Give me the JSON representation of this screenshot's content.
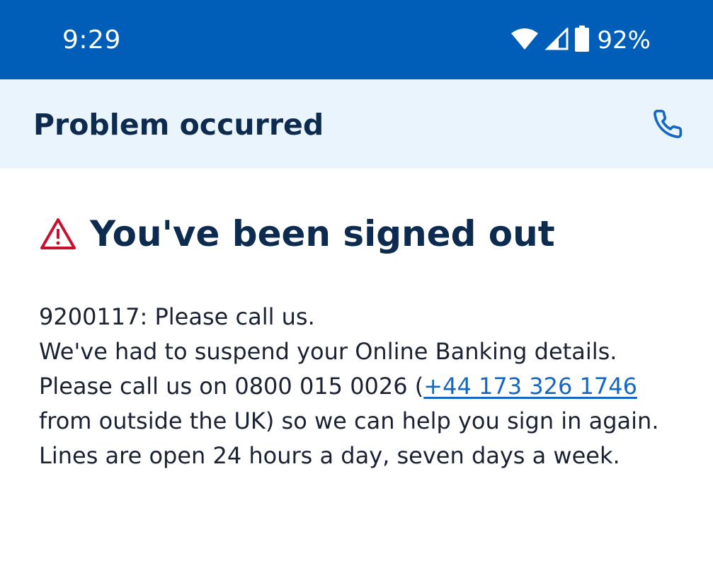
{
  "status_bar": {
    "time": "9:29",
    "icons": [
      "wifi-icon",
      "cell-signal-icon",
      "battery-icon"
    ],
    "battery_percent": "92%"
  },
  "header": {
    "title": "Problem occurred",
    "action_icon": "phone-icon"
  },
  "alert": {
    "icon": "warning-triangle-icon",
    "title": "You've been signed out",
    "code_line": "9200117: Please call us.",
    "line2": "We've had to suspend your Online Banking details.",
    "line3_prefix": "Please call us on 0800 015 0026 (",
    "international_number": "+44 173 326 1746",
    "line3_suffix": " from outside the UK) so we can help you sign in again. Lines are open 24 hours a day, seven days a week."
  },
  "colors": {
    "status_bar": "#005eb8",
    "header_background": "#eaf4fc",
    "heading_text": "#0d2a4f",
    "warning": "#c8102e",
    "link": "#1667c1"
  }
}
